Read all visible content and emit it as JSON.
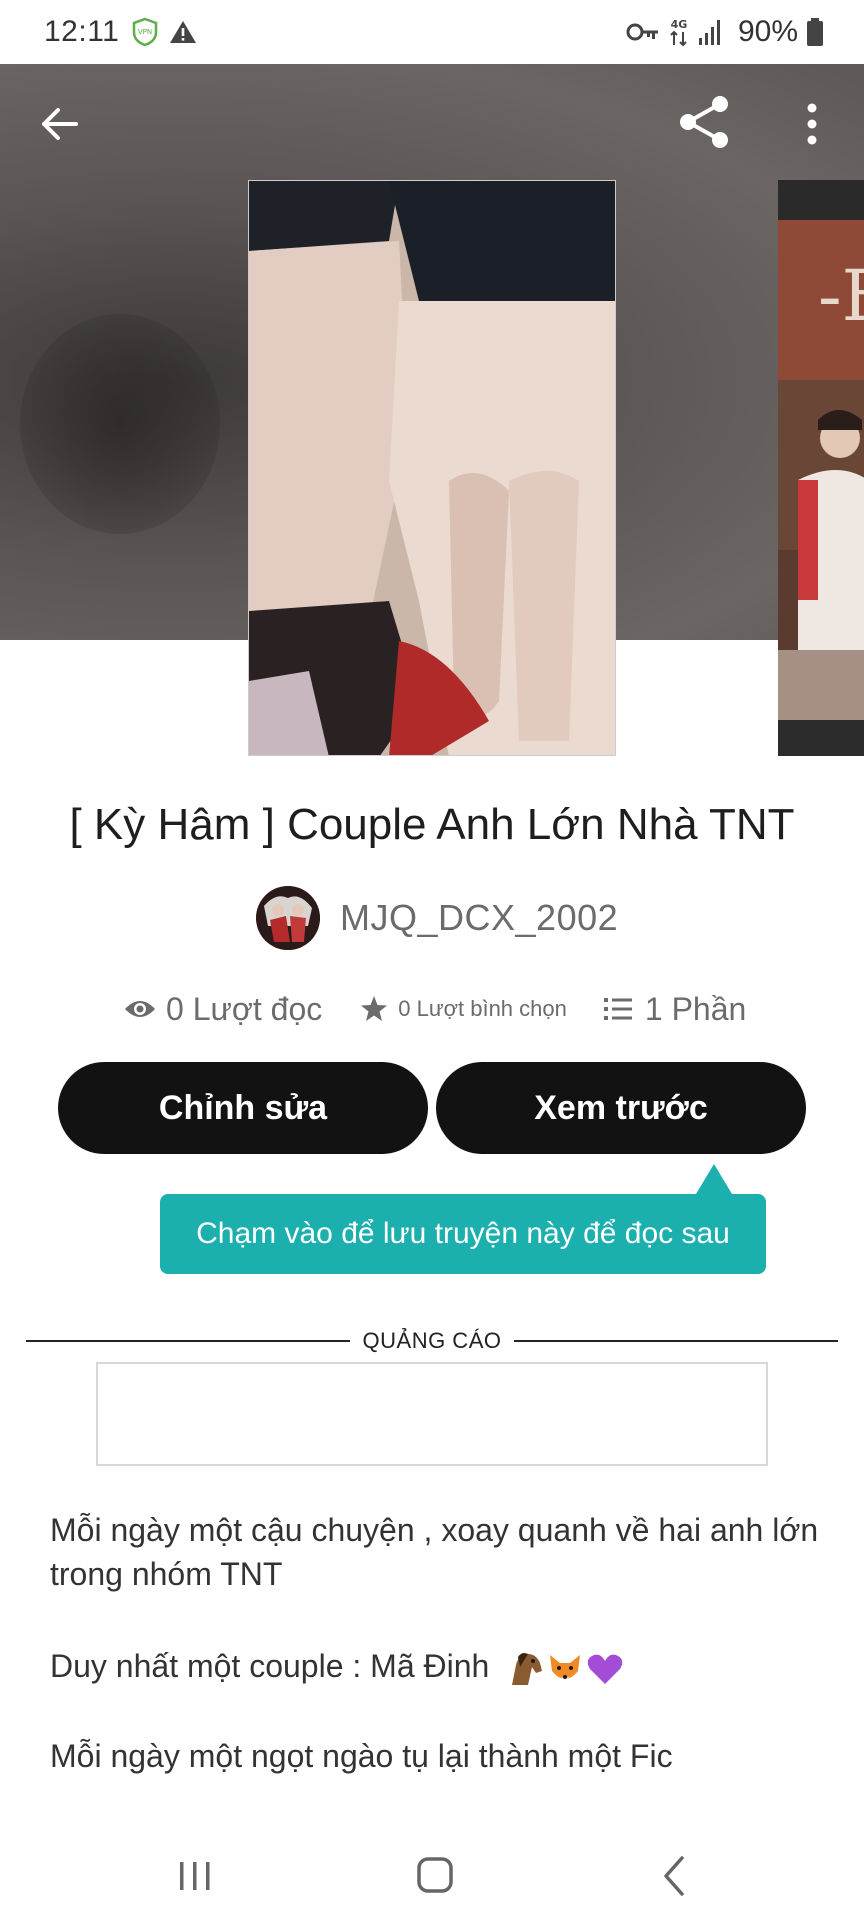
{
  "status_bar": {
    "time": "12:11",
    "network": "4G",
    "battery": "90%"
  },
  "header": {
    "back_icon": "arrow-left-icon",
    "share_icon": "share-icon",
    "more_icon": "more-vertical-icon"
  },
  "story": {
    "title": "[ Kỳ Hâm ] Couple Anh Lớn Nhà TNT",
    "author": "MJQ_DCX_2002",
    "reads": "0 Lượt đọc",
    "votes": "0 Lượt bình chọn",
    "parts": "1 Phần"
  },
  "actions": {
    "edit_label": "Chỉnh sửa",
    "preview_label": "Xem trước"
  },
  "tooltip": {
    "text": "Chạm vào để lưu truyện này để đọc sau"
  },
  "ad": {
    "label": "QUẢNG CÁO"
  },
  "description": {
    "line1": "Mỗi ngày một cậu chuyện , xoay quanh về hai anh lớn trong nhóm TNT",
    "line2": "Duy nhất một couple : Mã Đinh",
    "line3": "Mỗi ngày một ngọt ngào tụ lại thành một Fic"
  },
  "colors": {
    "button_bg": "#121212",
    "tooltip_bg": "#1bb0ae",
    "muted_text": "#6b6b6b"
  }
}
